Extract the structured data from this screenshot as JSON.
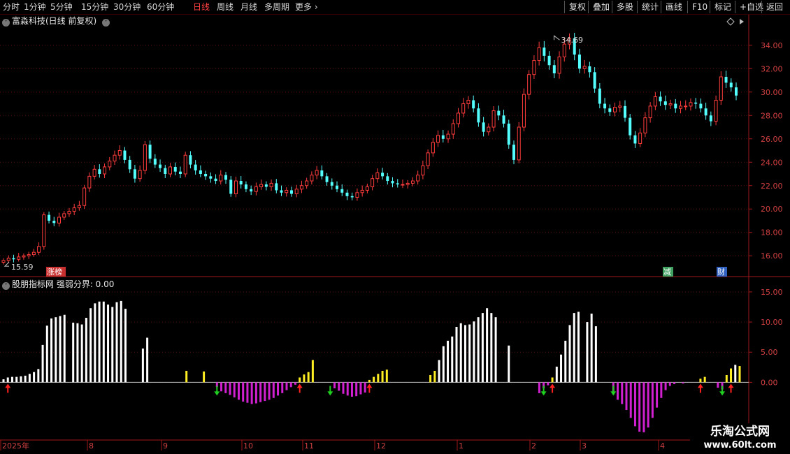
{
  "toolbar": {
    "periods": [
      "分时",
      "1分钟",
      "5分钟",
      "15分钟",
      "30分钟",
      "60分钟",
      "日线",
      "周线",
      "月线",
      "多周期",
      "更多"
    ],
    "active_period": "日线",
    "right_buttons": [
      "复权",
      "叠加",
      "多股",
      "统计",
      "画线",
      "F10",
      "标记",
      "+自选",
      "返回"
    ]
  },
  "main_panel": {
    "title": "富淼科技(日线 前复权)",
    "high_label": "34.69",
    "low_label": "15.59",
    "badges": [
      {
        "text": "涨榜",
        "color": "#c83030"
      },
      {
        "text": "减",
        "color": "#40a060"
      },
      {
        "text": "财",
        "color": "#3060c0"
      }
    ]
  },
  "sub_panel": {
    "title": "股朋指标网 强弱分界: 0.00"
  },
  "watermark": {
    "line1": "乐淘公式网",
    "line2": "www.60lt.com"
  },
  "chart_data": [
    {
      "type": "candlestick",
      "title": "富淼科技(日线 前复权)",
      "y_ticks": [
        "16.00",
        "18.00",
        "20.00",
        "22.00",
        "24.00",
        "26.00",
        "28.00",
        "30.00",
        "32.00",
        "34.00"
      ],
      "ylim": [
        14.7,
        35.6
      ],
      "x_months": [
        "2025年",
        "8",
        "9",
        "10",
        "11",
        "12",
        "1",
        "2",
        "3",
        "4"
      ],
      "max_price": 34.69,
      "min_price": 15.59,
      "close_series": [
        15.6,
        15.8,
        15.7,
        15.9,
        16.0,
        16.1,
        16.3,
        16.8,
        19.5,
        19.0,
        18.8,
        19.3,
        19.6,
        19.8,
        20.1,
        20.3,
        21.8,
        22.8,
        23.4,
        23.0,
        23.6,
        24.1,
        24.6,
        25.0,
        24.2,
        23.4,
        22.6,
        23.3,
        25.5,
        24.3,
        23.8,
        23.5,
        23.0,
        23.6,
        23.2,
        23.0,
        24.6,
        23.8,
        23.3,
        23.0,
        22.8,
        22.6,
        22.4,
        22.9,
        22.5,
        21.3,
        22.4,
        22.1,
        21.7,
        21.5,
        21.9,
        22.1,
        21.9,
        22.2,
        21.6,
        21.4,
        21.6,
        21.3,
        21.7,
        22.0,
        22.4,
        22.9,
        23.3,
        22.8,
        22.3,
        22.0,
        21.7,
        21.4,
        21.1,
        21.0,
        21.4,
        21.6,
        21.9,
        22.6,
        23.1,
        22.8,
        22.4,
        22.2,
        22.1,
        22.1,
        22.2,
        22.4,
        22.9,
        23.7,
        24.8,
        25.7,
        26.3,
        26.0,
        26.4,
        27.3,
        28.2,
        29.0,
        29.3,
        28.6,
        27.4,
        26.6,
        27.0,
        28.4,
        28.0,
        27.3,
        25.5,
        24.2,
        27.0,
        29.8,
        31.5,
        32.7,
        33.8,
        33.1,
        32.3,
        31.6,
        33.0,
        34.1,
        34.6,
        33.2,
        32.0,
        32.2,
        31.7,
        30.3,
        29.0,
        28.6,
        28.3,
        28.7,
        28.8,
        27.8,
        26.3,
        25.6,
        26.5,
        27.8,
        28.8,
        29.6,
        29.2,
        28.9,
        29.0,
        28.6,
        28.8,
        28.8,
        29.1,
        29.0,
        28.6,
        28.0,
        27.5,
        29.3,
        31.3,
        30.8,
        30.4,
        29.7
      ],
      "badges": [
        "涨榜",
        "减",
        "财"
      ]
    },
    {
      "type": "bar",
      "title": "股朋指标网 强弱分界",
      "boundary": 0.0,
      "y_ticks": [
        "15.00",
        "10.00",
        "5.00",
        "0.00"
      ],
      "ylim": [
        -9,
        16.5
      ],
      "color_legend": {
        "strong": "#ffffff",
        "weak": "#d020d0",
        "transition": "#ffee22"
      },
      "values": [
        0.5,
        0.8,
        0.9,
        0.9,
        1.0,
        1.1,
        1.4,
        1.7,
        2.2,
        6.2,
        9.4,
        10.6,
        10.8,
        11.0,
        11.2,
        0,
        9.9,
        9.8,
        9.6,
        10.7,
        12.3,
        13.1,
        13.4,
        13.4,
        12.9,
        12.5,
        13.3,
        13.5,
        12.2,
        0,
        0,
        0,
        5.6,
        7.4,
        0,
        0,
        0,
        0,
        0,
        0,
        0,
        0,
        1.9,
        0,
        0,
        0,
        1.8,
        0,
        0,
        -0.8,
        -1.5,
        -1.8,
        -2.1,
        -2.5,
        -2.9,
        -3.2,
        -3.4,
        -3.6,
        -3.5,
        -3.3,
        -3.1,
        -2.9,
        -2.6,
        -2.2,
        -1.8,
        -1.3,
        -0.8,
        -0.4,
        0.8,
        1.3,
        1.7,
        3.7,
        0,
        0,
        0,
        0,
        -1.0,
        -1.4,
        -1.9,
        -2.2,
        -2.4,
        -2.3,
        -2.0,
        -1.7,
        0.4,
        0.9,
        1.4,
        1.9,
        2.1,
        0,
        0,
        0,
        0,
        0,
        0,
        0,
        0,
        0,
        1.2,
        1.9,
        3.7,
        6.0,
        6.9,
        7.6,
        9.2,
        9.8,
        9.5,
        9.6,
        10.1,
        10.8,
        11.5,
        12.3,
        11.5,
        10.8,
        0,
        0,
        6.1,
        0,
        0,
        0,
        0,
        0,
        0,
        -1.8,
        -1.0,
        -0.5,
        0.8,
        2.6,
        4.6,
        6.9,
        9.5,
        11.5,
        11.7,
        0,
        10.0,
        11.4,
        9.3,
        0,
        0,
        0,
        -2.0,
        -2.9,
        -3.6,
        -4.6,
        -5.9,
        -7.3,
        -8.2,
        -8.3,
        -7.5,
        -5.9,
        -4.2,
        -2.6,
        -1.3,
        -0.6,
        -0.3,
        0,
        -0.2,
        0,
        0,
        0,
        0.6,
        0.9,
        0,
        0,
        -0.9,
        -1.2,
        1.2,
        2.3,
        2.9,
        2.7
      ],
      "arrows": [
        {
          "index": 1,
          "dir": "up"
        },
        {
          "index": 49,
          "dir": "down"
        },
        {
          "index": 68,
          "dir": "up"
        },
        {
          "index": 75,
          "dir": "down"
        },
        {
          "index": 84,
          "dir": "up"
        },
        {
          "index": 124,
          "dir": "down"
        },
        {
          "index": 126,
          "dir": "up"
        },
        {
          "index": 140,
          "dir": "down"
        },
        {
          "index": 160,
          "dir": "up"
        },
        {
          "index": 165,
          "dir": "down"
        },
        {
          "index": 167,
          "dir": "up"
        }
      ]
    }
  ]
}
